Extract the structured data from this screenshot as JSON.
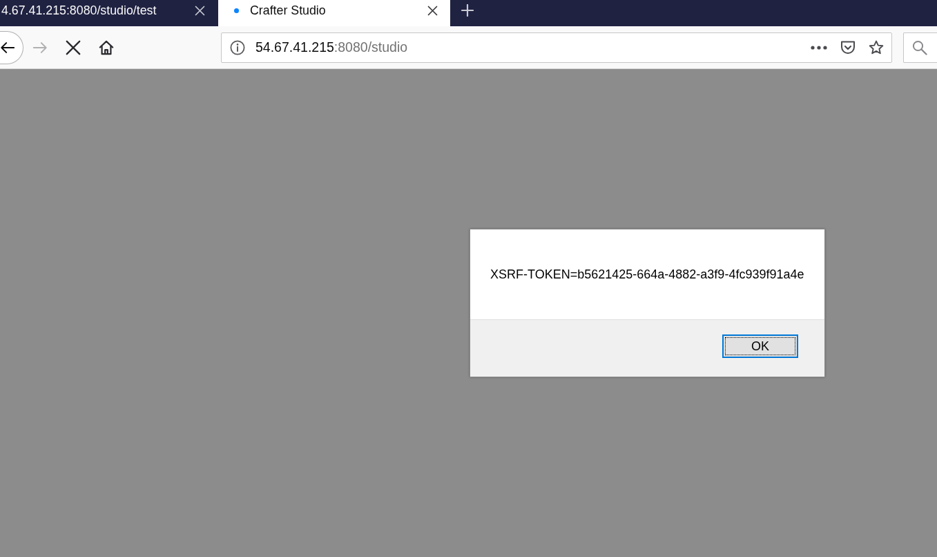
{
  "tabs": [
    {
      "title": "4.67.41.215:8080/studio/test",
      "selected": false,
      "loading": false
    },
    {
      "title": "Crafter Studio",
      "selected": true,
      "loading": true
    }
  ],
  "toolbar": {
    "nav_buttons": [
      {
        "kind": "back",
        "disabled": false
      },
      {
        "kind": "forward",
        "disabled": true
      },
      {
        "kind": "stop",
        "disabled": false
      },
      {
        "kind": "home",
        "disabled": false
      }
    ],
    "address_bar": {
      "host": "54.67.41.215",
      "path": ":8080/studio"
    }
  },
  "dialog": {
    "message": "XSRF-TOKEN=b5621425-664a-4882-a3f9-4fc939f91a4e",
    "buttons": [
      {
        "label": "OK",
        "focused": true
      }
    ]
  }
}
